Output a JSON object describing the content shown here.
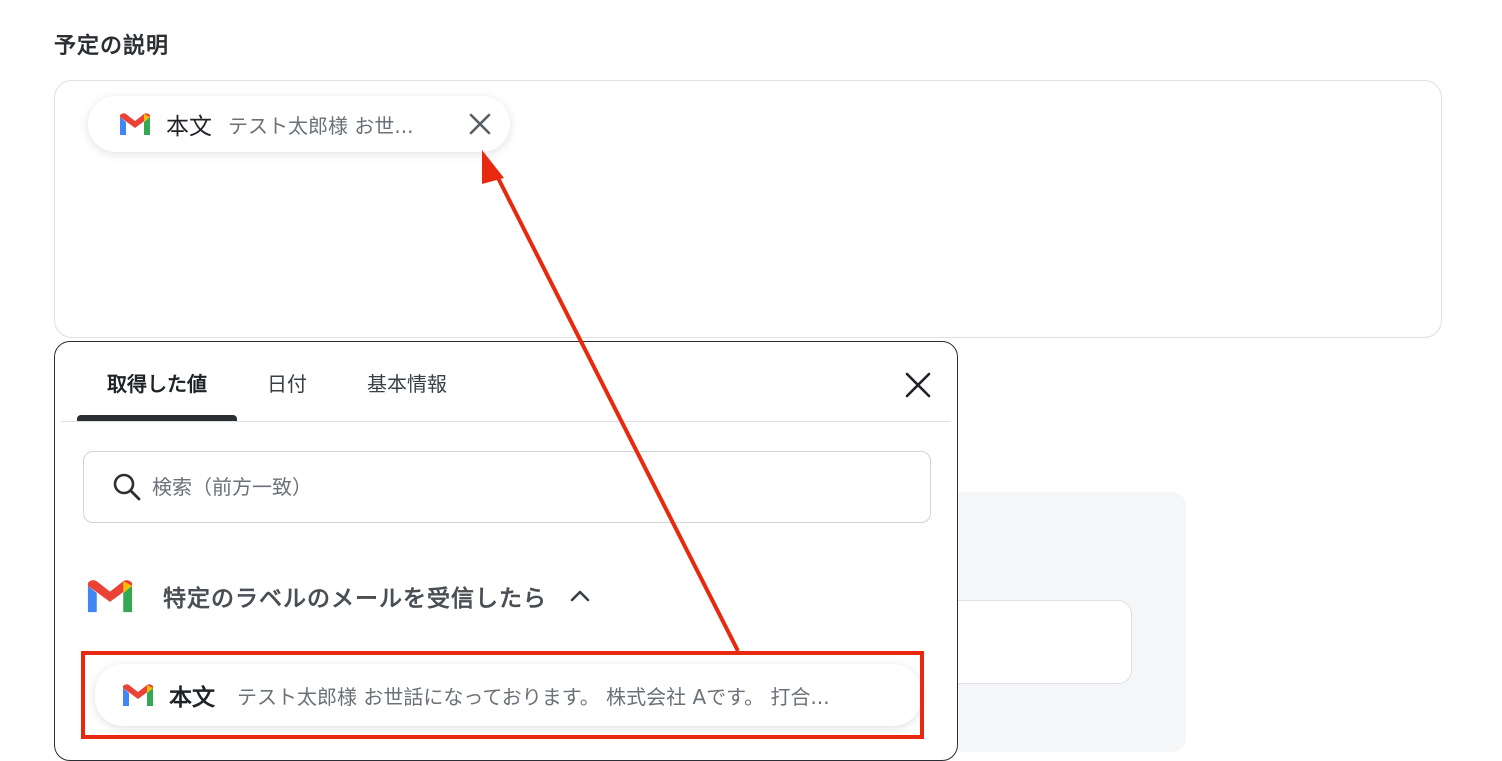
{
  "field": {
    "label": "予定の説明"
  },
  "inserted_chip": {
    "icon": "gmail-icon",
    "field_name": "本文",
    "value_preview": "テスト太郎様 お世..."
  },
  "picker": {
    "tabs": [
      {
        "label": "取得した値",
        "active": true
      },
      {
        "label": "日付",
        "active": false
      },
      {
        "label": "基本情報",
        "active": false
      }
    ],
    "search": {
      "placeholder": "検索（前方一致）"
    },
    "section": {
      "icon": "gmail-icon",
      "label": "特定のラベルのメールを受信したら",
      "expanded": true
    },
    "items": [
      {
        "icon": "gmail-icon",
        "field_name": "本文",
        "value_preview": "テスト太郎様 お世話になっております。 株式会社 Aです。 打合..."
      }
    ]
  },
  "colors": {
    "annotation_red": "#e8290f",
    "gmail_red": "#ea4335",
    "gmail_blue": "#4285f4",
    "gmail_green": "#34a853",
    "gmail_yellow": "#fbbc04"
  }
}
